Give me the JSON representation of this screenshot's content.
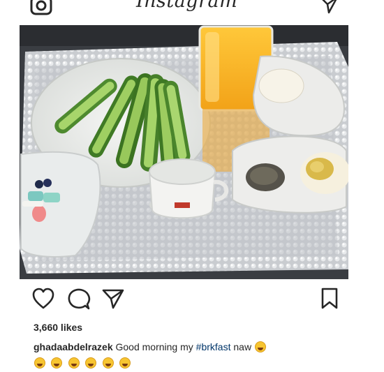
{
  "header": {
    "logo": "Instagram",
    "camera_icon": "camera-icon",
    "direct_icon": "paper-plane-icon"
  },
  "post": {
    "image_alt": "breakfast tray with cucumbers, orange juice, boiled eggs, cup and herbs",
    "actions": {
      "like_icon": "heart-icon",
      "comment_icon": "comment-bubble-icon",
      "share_icon": "paper-plane-icon",
      "save_icon": "bookmark-icon"
    },
    "likes": "3,660 likes",
    "caption": {
      "username": "ghadaabdelrazek",
      "text_before": "Good morning my ",
      "hashtag": "#brkfast",
      "text_after": " naw",
      "emoji_name": "laughing-tears-emoji",
      "emoji_count_line1": 1,
      "emoji_count_line2": 6
    }
  },
  "colors": {
    "text": "#262626",
    "hashtag": "#003569",
    "background": "#ffffff"
  }
}
